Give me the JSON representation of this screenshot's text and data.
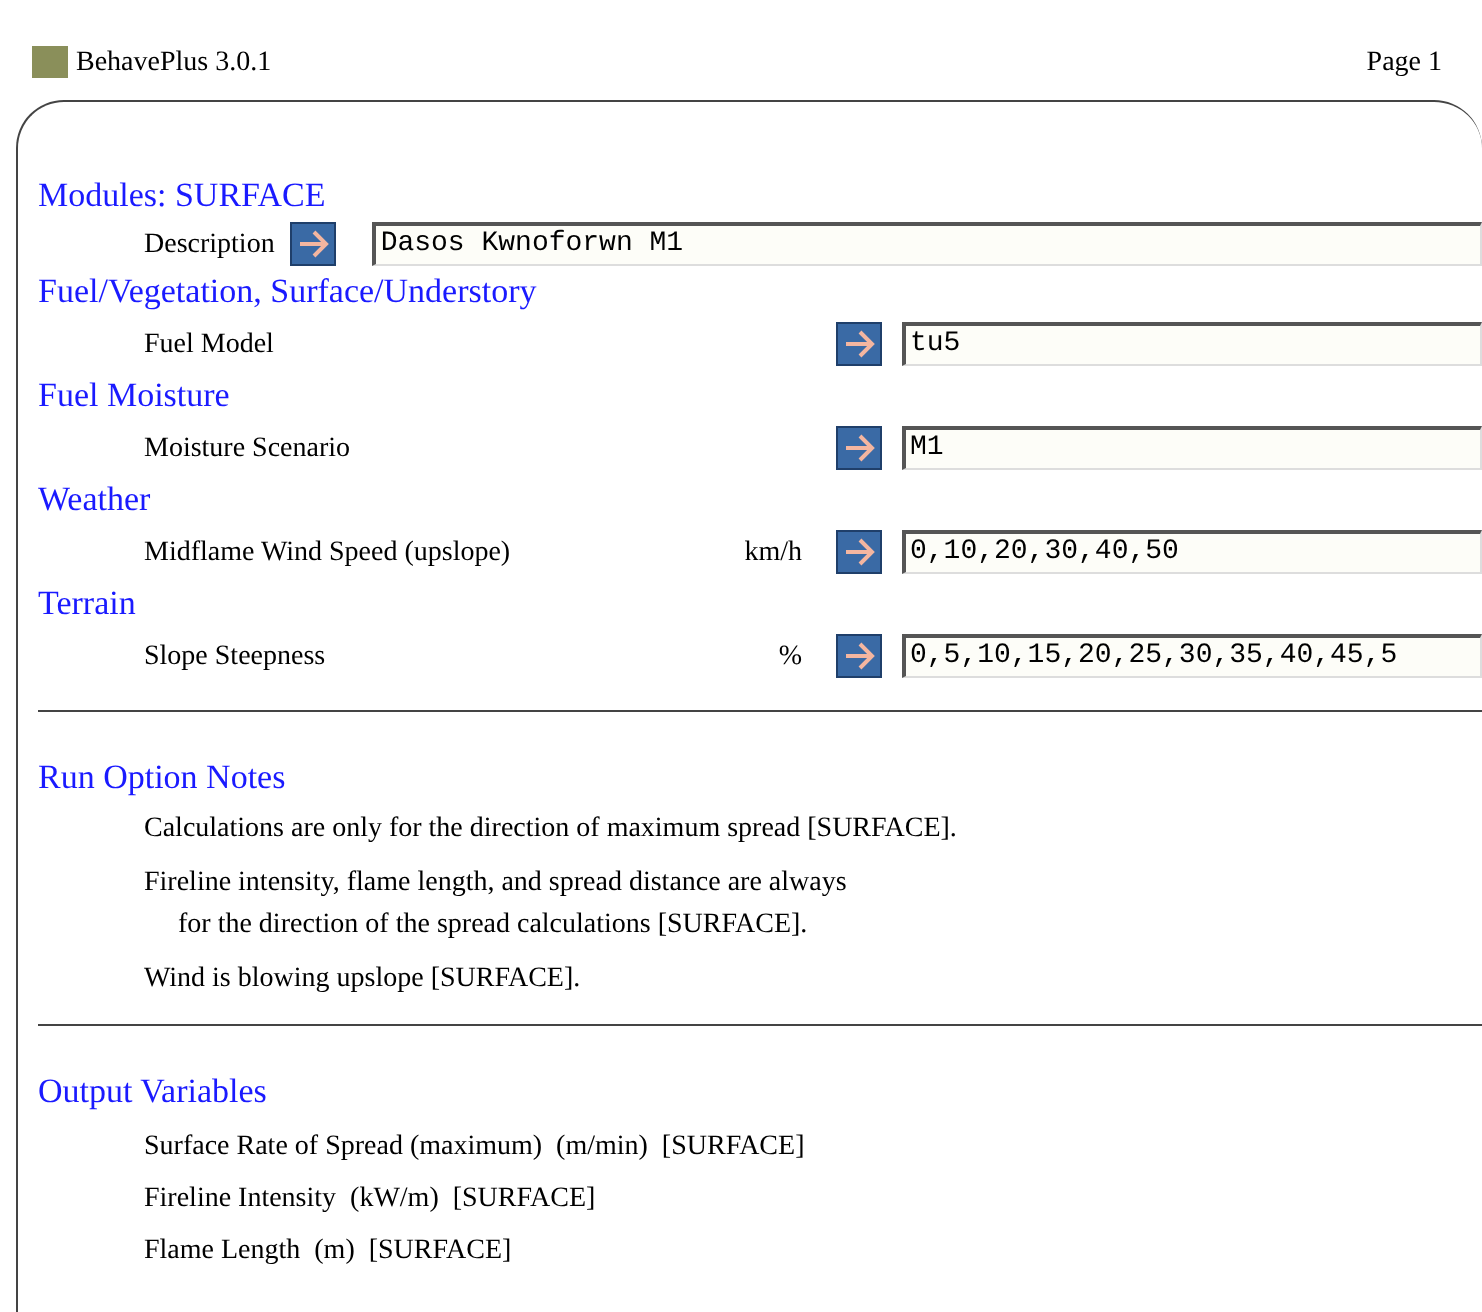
{
  "header": {
    "app_title": "BehavePlus 3.0.1",
    "page": "Page 1"
  },
  "modules": {
    "heading": "Modules: SURFACE",
    "description_label": "Description",
    "description_value": "Dasos Kwnoforwn M1"
  },
  "input_groups": [
    {
      "heading": "Fuel/Vegetation, Surface/Understory",
      "inputs": [
        {
          "label": "Fuel Model",
          "value": "tu5"
        }
      ]
    },
    {
      "heading": "Fuel Moisture",
      "inputs": [
        {
          "label": "Moisture Scenario",
          "value": "M1"
        }
      ]
    },
    {
      "heading": "Weather",
      "inputs": [
        {
          "label": "Midflame Wind Speed (upslope)",
          "units": "km/h",
          "value": "0,10,20,30,40,50"
        }
      ]
    },
    {
      "heading": "Terrain",
      "inputs": [
        {
          "label": "Slope Steepness",
          "units": "%",
          "value": "0,5,10,15,20,25,30,35,40,45,5"
        }
      ]
    }
  ],
  "run_option_notes": {
    "heading": "Run Option Notes",
    "notes": [
      {
        "lines": [
          "Calculations are only for the direction of maximum spread [SURFACE]."
        ]
      },
      {
        "lines": [
          "Fireline intensity, flame length, and spread distance are always",
          "for the direction of the spread calculations [SURFACE]."
        ]
      },
      {
        "lines": [
          "Wind is blowing upslope [SURFACE]."
        ]
      }
    ]
  },
  "output_variables": {
    "heading": "Output Variables",
    "items": [
      "Surface Rate of Spread (maximum)  (m/min)  [SURFACE]",
      "Fireline Intensity  (kW/m)  [SURFACE]",
      "Flame Length  (m)  [SURFACE]"
    ]
  }
}
